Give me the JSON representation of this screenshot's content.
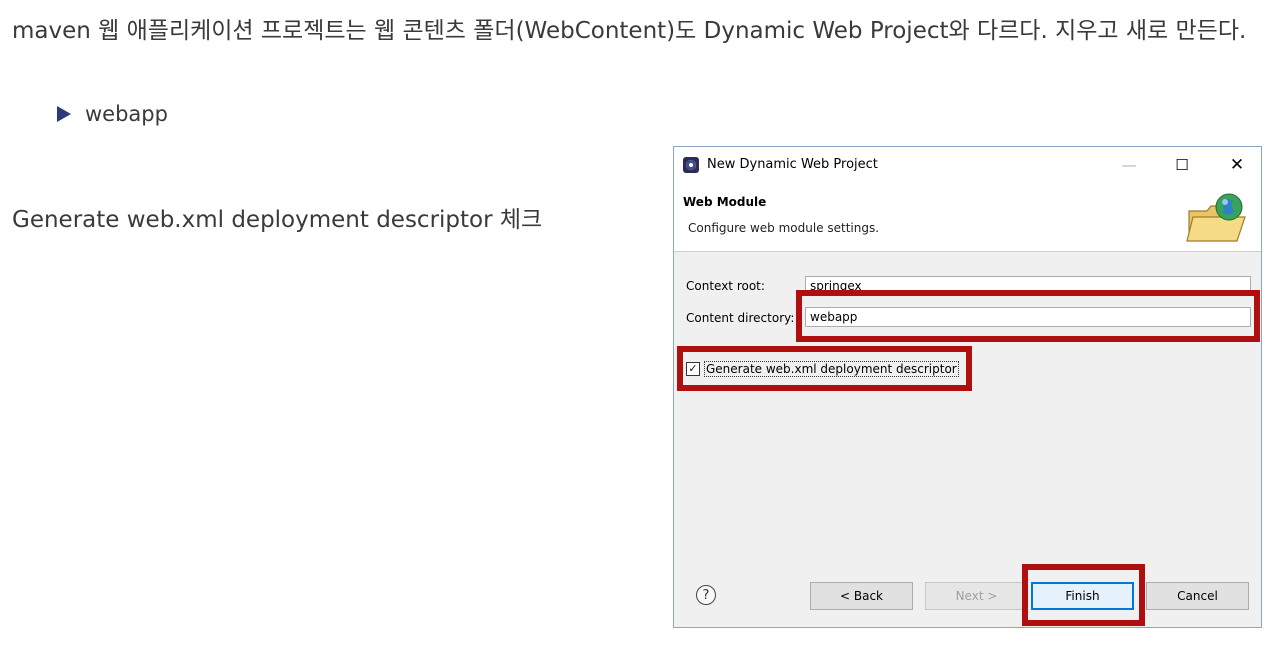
{
  "slide": {
    "heading": "maven 웹 애플리케이션 프로젝트는 웹 콘텐츠 폴더(WebContent)도 Dynamic Web Project와 다르다. 지우고 새로 만든다.",
    "bullet": "webapp",
    "note": "Generate web.xml deployment descriptor 체크"
  },
  "dialog": {
    "title": "New Dynamic Web Project",
    "window_controls": {
      "minimize": "—",
      "maximize": "☐",
      "close": "✕"
    },
    "banner_title": "Web Module",
    "banner_subtitle": "Configure web module settings.",
    "context_root_label": "Context root:",
    "context_root_value": "springex",
    "content_dir_label": "Content directory:",
    "content_dir_value": "webapp",
    "generate_checkbox_label": "Generate web.xml deployment descriptor",
    "generate_checked": true,
    "help_symbol": "?",
    "buttons": {
      "back": "< Back",
      "next": "Next >",
      "finish": "Finish",
      "cancel": "Cancel"
    },
    "icons": [
      "eclipse-app-icon",
      "globe-folder-icon",
      "help-icon"
    ],
    "highlight_color": "#b00f0f"
  }
}
